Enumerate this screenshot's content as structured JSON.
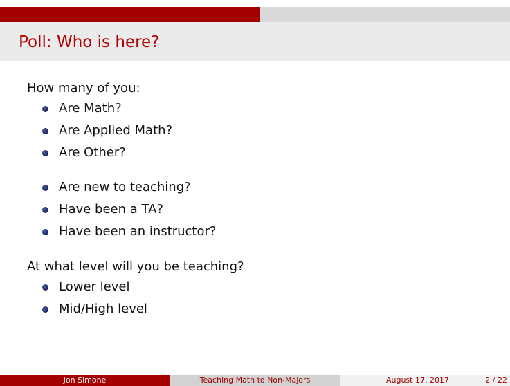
{
  "slide": {
    "title": "Poll: Who is here?",
    "progress": 0.51,
    "intro": "How many of you:",
    "group_1": [
      "Are Math?",
      "Are Applied Math?",
      "Are Other?"
    ],
    "group_2": [
      "Are new to teaching?",
      "Have been a TA?",
      "Have been an instructor?"
    ],
    "question_2": "At what level will you be teaching?",
    "group_3": [
      "Lower level",
      "Mid/High level"
    ]
  },
  "footer": {
    "author": "Jon Simone",
    "talk_title": "Teaching Math to Non-Majors",
    "date": "August 17, 2017",
    "page": "2 / 22"
  },
  "colors": {
    "accent": "#a40000",
    "title": "#b30000",
    "bullet": "#24306b"
  }
}
